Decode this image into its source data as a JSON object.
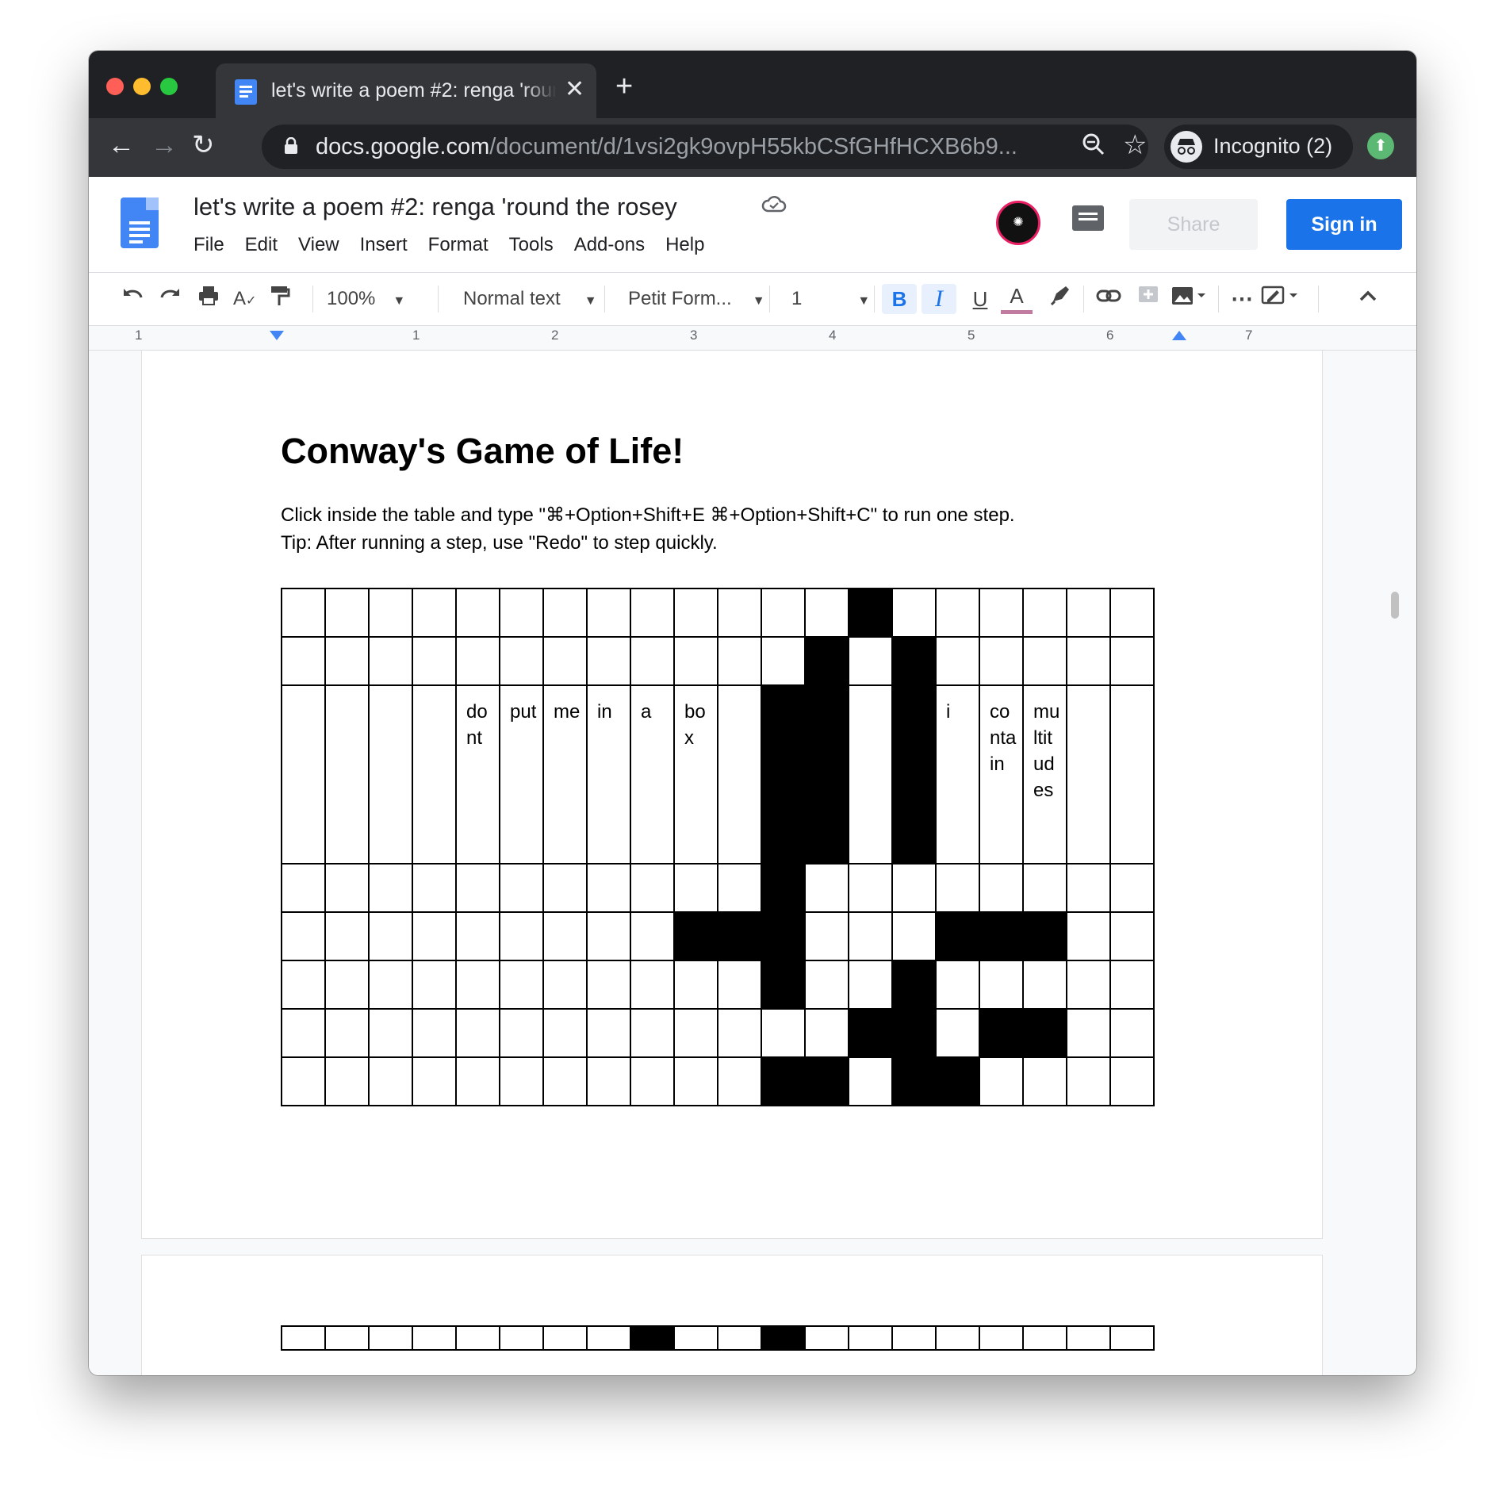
{
  "browser": {
    "tab_title": "let's write a poem #2: renga 'round the rosey",
    "tab_close": "✕",
    "new_tab": "+",
    "back": "←",
    "forward": "→",
    "reload": "↻",
    "url_host": "docs.google.com",
    "url_path": "/document/d/1vsi2gk9ovpH55kbCSfGHfHCXB6b9...",
    "zoom_icon": "zoom-icon",
    "star_icon": "☆",
    "incognito_label": "Incognito (2)"
  },
  "docs": {
    "title": "let's write a poem #2: renga 'round the rosey",
    "menu": [
      "File",
      "Edit",
      "View",
      "Insert",
      "Format",
      "Tools",
      "Add-ons",
      "Help"
    ],
    "share_label": "Share",
    "signin_label": "Sign in"
  },
  "toolbar": {
    "zoom": "100%",
    "style": "Normal text",
    "font": "Petit Form...",
    "size": "1",
    "bold": "B",
    "italic": "I",
    "underline": "U",
    "text_color": "A"
  },
  "ruler": {
    "numbers": [
      "1",
      "1",
      "2",
      "3",
      "4",
      "5",
      "6",
      "7"
    ]
  },
  "document": {
    "heading": "Conway's Game of Life!",
    "instruction": "Click inside the table and type \"⌘+Option+Shift+E ⌘+Option+Shift+C\" to run one step.",
    "tip": "Tip: After running a step, use \"Redo\" to step quickly."
  },
  "grid": {
    "rows": [
      [
        0,
        0,
        0,
        0,
        0,
        0,
        0,
        0,
        0,
        0,
        0,
        0,
        0,
        1,
        0,
        0,
        0,
        0,
        0,
        0
      ],
      [
        0,
        0,
        0,
        0,
        0,
        0,
        0,
        0,
        0,
        0,
        0,
        0,
        1,
        0,
        1,
        0,
        0,
        0,
        0,
        0
      ],
      [
        0,
        0,
        0,
        0,
        0,
        0,
        0,
        0,
        0,
        0,
        0,
        1,
        1,
        0,
        1,
        0,
        0,
        0,
        0,
        0
      ],
      [
        0,
        0,
        0,
        0,
        0,
        0,
        0,
        0,
        0,
        0,
        0,
        1,
        0,
        0,
        0,
        0,
        0,
        0,
        0,
        0
      ],
      [
        0,
        0,
        0,
        0,
        0,
        0,
        0,
        0,
        0,
        1,
        1,
        1,
        0,
        0,
        0,
        1,
        1,
        1,
        0,
        0
      ],
      [
        0,
        0,
        0,
        0,
        0,
        0,
        0,
        0,
        0,
        0,
        0,
        1,
        0,
        0,
        1,
        0,
        0,
        0,
        0,
        0
      ],
      [
        0,
        0,
        0,
        0,
        0,
        0,
        0,
        0,
        0,
        0,
        0,
        0,
        0,
        1,
        1,
        0,
        1,
        1,
        0,
        0
      ],
      [
        0,
        0,
        0,
        0,
        0,
        0,
        0,
        0,
        0,
        0,
        0,
        1,
        1,
        0,
        1,
        1,
        0,
        0,
        0,
        0
      ]
    ],
    "cell_text": {
      "2-4": "dont",
      "2-5": "put",
      "2-6": "me",
      "2-7": "in",
      "2-8": "a",
      "2-9": "box",
      "2-15": "i",
      "2-16": "contain",
      "2-17": "multitudes"
    }
  },
  "next_grid_top_row": [
    0,
    0,
    0,
    0,
    0,
    0,
    0,
    0,
    1,
    0,
    0,
    1,
    0,
    0,
    0,
    0,
    0,
    0,
    0,
    0
  ],
  "colors": {
    "chrome_dark": "#202124",
    "chrome_tab": "#35363a",
    "docs_blue": "#4285f4",
    "signin_blue": "#1a73e8",
    "alive_cell": "#000000",
    "avatar_ring": "#e91e63"
  }
}
